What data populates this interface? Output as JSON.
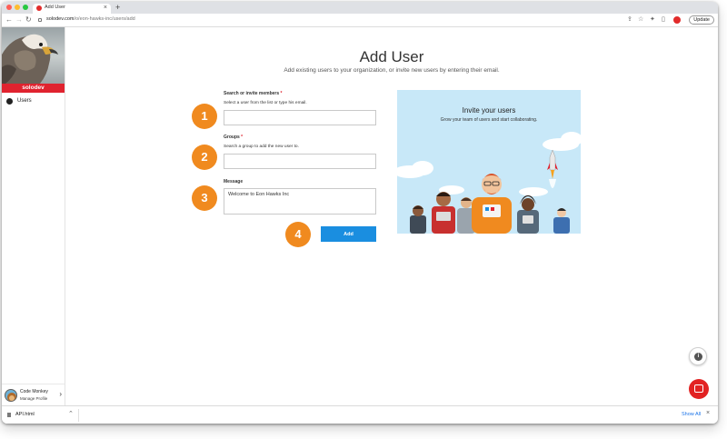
{
  "browser": {
    "tab_title": "Add User",
    "tab_close": "×",
    "new_tab": "+",
    "url_host": "solodev.com",
    "url_path": "/o/eon-hawks-inc/users/add",
    "update_label": "Update",
    "icons": [
      "back-icon",
      "forward-icon",
      "reload-icon",
      "lock-icon",
      "share-icon",
      "star-icon",
      "extensions-icon",
      "sidebar-icon",
      "profile-icon",
      "menu-icon"
    ]
  },
  "sidebar": {
    "brand": "solodev",
    "items": [
      {
        "label": "Users",
        "icon": "users-icon"
      }
    ],
    "user": {
      "name": "Code Monkey",
      "subtitle": "Manage Profile"
    }
  },
  "page": {
    "title": "Add User",
    "subtitle": "Add existing users to your organization, or invite new users by entering their email."
  },
  "form": {
    "search": {
      "label": "Search or invite members",
      "required_mark": "*",
      "help": "Select a user from the list or type his email.",
      "value": "",
      "placeholder": ""
    },
    "groups": {
      "label": "Groups",
      "required_mark": "*",
      "help": "Search a group to add the new user to.",
      "value": "",
      "placeholder": ""
    },
    "message": {
      "label": "Message",
      "value": "Welcome to Eon Hawks Inc"
    },
    "submit_label": "Add"
  },
  "steps": [
    "1",
    "2",
    "3",
    "4"
  ],
  "promo": {
    "title": "Invite your users",
    "subtitle": "Grow your team of users and start collaborating."
  },
  "download_bar": {
    "file_name": "API.html",
    "show_all": "Show All",
    "close": "×"
  },
  "colors": {
    "brand_red": "#e0232f",
    "step_orange": "#f08a1f",
    "primary_blue": "#1a8ee0",
    "promo_sky": "#c8e8f8"
  }
}
